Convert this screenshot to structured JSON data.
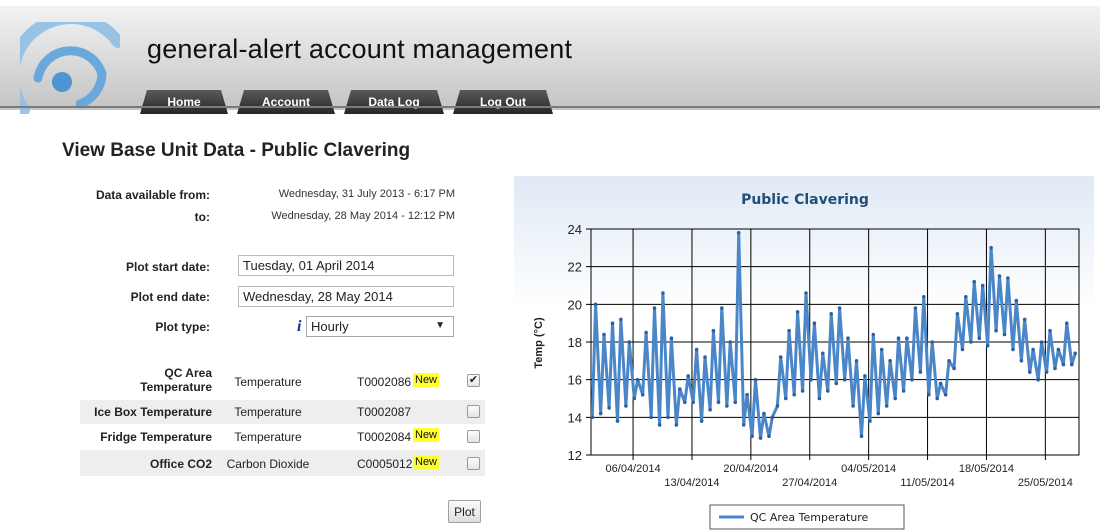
{
  "app": {
    "title": "general-alert account management"
  },
  "nav": {
    "items": [
      "Home",
      "Account",
      "Data Log",
      "Log Out"
    ]
  },
  "page": {
    "title": "View Base Unit Data - Public Clavering"
  },
  "availability": {
    "from_label": "Data available from:",
    "from_value": "Wednesday, 31 July 2013 - 6:17 PM",
    "to_label": "to:",
    "to_value": "Wednesday, 28 May 2014 - 12:12 PM"
  },
  "plot_form": {
    "start_label": "Plot start date:",
    "start_value": "Tuesday, 01 April 2014",
    "end_label": "Plot end date:",
    "end_value": "Wednesday, 28 May 2014",
    "type_label": "Plot type:",
    "type_value": "Hourly",
    "info_glyph": "i",
    "dropdown_glyph": "▼"
  },
  "sensors": [
    {
      "name_line1": "QC Area",
      "name_line2": "Temperature",
      "type": "Temperature",
      "serial": "T0002086",
      "new": "New",
      "checked": true
    },
    {
      "name_line1": "Ice Box Temperature",
      "name_line2": "",
      "type": "Temperature",
      "serial": "T0002087",
      "new": "",
      "checked": false
    },
    {
      "name_line1": "Fridge Temperature",
      "name_line2": "",
      "type": "Temperature",
      "serial": "T0002084",
      "new": "New",
      "checked": false
    },
    {
      "name_line1": "Office CO2",
      "name_line2": "",
      "type": "Carbon Dioxide",
      "serial": "C0005012",
      "new": "New",
      "checked": false
    }
  ],
  "checkbox_glyph": "✔",
  "plot_button": "Plot",
  "colors": {
    "series": "#4a86c8",
    "series_marker": "#2f5f9e",
    "title": "#1f4e79",
    "nav_bg": "#3a3a3a",
    "new_badge": "#ffff33"
  },
  "chart_data": {
    "type": "line",
    "title": "Public Clavering",
    "xlabel": "",
    "ylabel": "Temp (°C)",
    "ylim": [
      12,
      24
    ],
    "yticks": [
      12,
      14,
      16,
      18,
      20,
      22,
      24
    ],
    "x_range": [
      "2014-04-01",
      "2014-05-28"
    ],
    "xticks": [
      {
        "date": "2014-04-06",
        "label": "06/04/2014",
        "row": 1
      },
      {
        "date": "2014-04-13",
        "label": "13/04/2014",
        "row": 2
      },
      {
        "date": "2014-04-20",
        "label": "20/04/2014",
        "row": 1
      },
      {
        "date": "2014-04-27",
        "label": "27/04/2014",
        "row": 2
      },
      {
        "date": "2014-05-04",
        "label": "04/05/2014",
        "row": 1
      },
      {
        "date": "2014-05-11",
        "label": "11/05/2014",
        "row": 2
      },
      {
        "date": "2014-05-18",
        "label": "18/05/2014",
        "row": 1
      },
      {
        "date": "2014-05-25",
        "label": "25/05/2014",
        "row": 2
      }
    ],
    "grid": true,
    "legend_position": "bottom",
    "series": [
      {
        "name": "QC Area Temperature",
        "x": [
          "2014-04-01",
          "2014-04-02",
          "2014-04-03",
          "2014-04-04",
          "2014-04-05",
          "2014-04-06",
          "2014-04-07",
          "2014-04-08",
          "2014-04-09",
          "2014-04-10",
          "2014-04-11",
          "2014-04-12",
          "2014-04-13",
          "2014-04-14",
          "2014-04-15",
          "2014-04-16",
          "2014-04-17",
          "2014-04-18",
          "2014-04-19",
          "2014-04-20",
          "2014-04-21",
          "2014-04-22",
          "2014-04-23",
          "2014-04-24",
          "2014-04-25",
          "2014-04-26",
          "2014-04-27",
          "2014-04-28",
          "2014-04-29",
          "2014-04-30",
          "2014-05-01",
          "2014-05-02",
          "2014-05-03",
          "2014-05-04",
          "2014-05-05",
          "2014-05-06",
          "2014-05-07",
          "2014-05-08",
          "2014-05-09",
          "2014-05-10",
          "2014-05-11",
          "2014-05-12",
          "2014-05-13",
          "2014-05-14",
          "2014-05-15",
          "2014-05-16",
          "2014-05-17",
          "2014-05-18",
          "2014-05-19",
          "2014-05-20",
          "2014-05-21",
          "2014-05-22",
          "2014-05-23",
          "2014-05-24",
          "2014-05-25",
          "2014-05-26",
          "2014-05-27",
          "2014-05-28"
        ],
        "max": [
          20.0,
          18.4,
          19.0,
          19.2,
          18.0,
          16.0,
          18.5,
          19.8,
          20.6,
          18.2,
          15.5,
          16.2,
          17.6,
          17.2,
          18.6,
          19.8,
          18.0,
          23.8,
          15.2,
          16.0,
          14.2,
          14.0,
          17.2,
          18.6,
          19.6,
          20.6,
          19.0,
          17.4,
          19.5,
          19.8,
          18.2,
          17.0,
          16.2,
          18.4,
          17.6,
          17.0,
          18.2,
          18.2,
          19.8,
          20.4,
          18.0,
          15.8,
          17.0,
          19.5,
          20.4,
          21.2,
          21.0,
          23.0,
          21.5,
          21.4,
          20.2,
          19.2,
          17.6,
          18.0,
          18.6,
          17.6,
          19.0,
          17.4
        ],
        "min": [
          14.0,
          14.2,
          14.5,
          13.8,
          14.6,
          15.0,
          15.2,
          14.0,
          13.6,
          14.0,
          13.6,
          14.8,
          14.8,
          13.8,
          14.4,
          14.8,
          14.6,
          14.8,
          13.6,
          13.0,
          12.9,
          13.0,
          14.6,
          15.0,
          15.2,
          15.4,
          16.0,
          15.0,
          15.4,
          15.8,
          16.0,
          14.6,
          13.0,
          13.8,
          14.2,
          14.6,
          15.0,
          15.4,
          16.0,
          16.4,
          15.2,
          15.0,
          15.2,
          16.6,
          17.6,
          18.0,
          18.2,
          17.8,
          18.6,
          18.4,
          17.6,
          17.0,
          16.4,
          16.0,
          16.4,
          16.6,
          16.8,
          16.8
        ]
      }
    ]
  }
}
